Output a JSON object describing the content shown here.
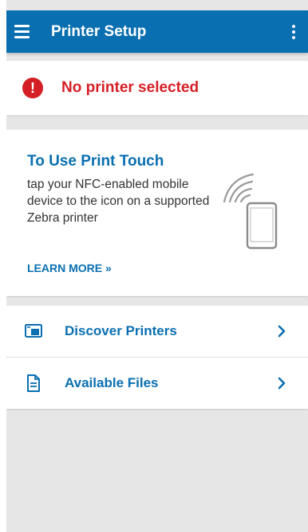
{
  "appbar": {
    "title": "Printer Setup"
  },
  "status": {
    "message": "No printer selected"
  },
  "print_touch": {
    "title": "To Use Print Touch",
    "body": "tap your NFC-enabled mobile device to the icon on a supported Zebra printer",
    "link": "LEARN MORE »"
  },
  "list": {
    "items": [
      {
        "label": "Discover Printers"
      },
      {
        "label": "Available Files"
      }
    ]
  },
  "colors": {
    "brand": "#0a6fb0",
    "error": "#d51f26",
    "background": "#e6e6e6"
  }
}
